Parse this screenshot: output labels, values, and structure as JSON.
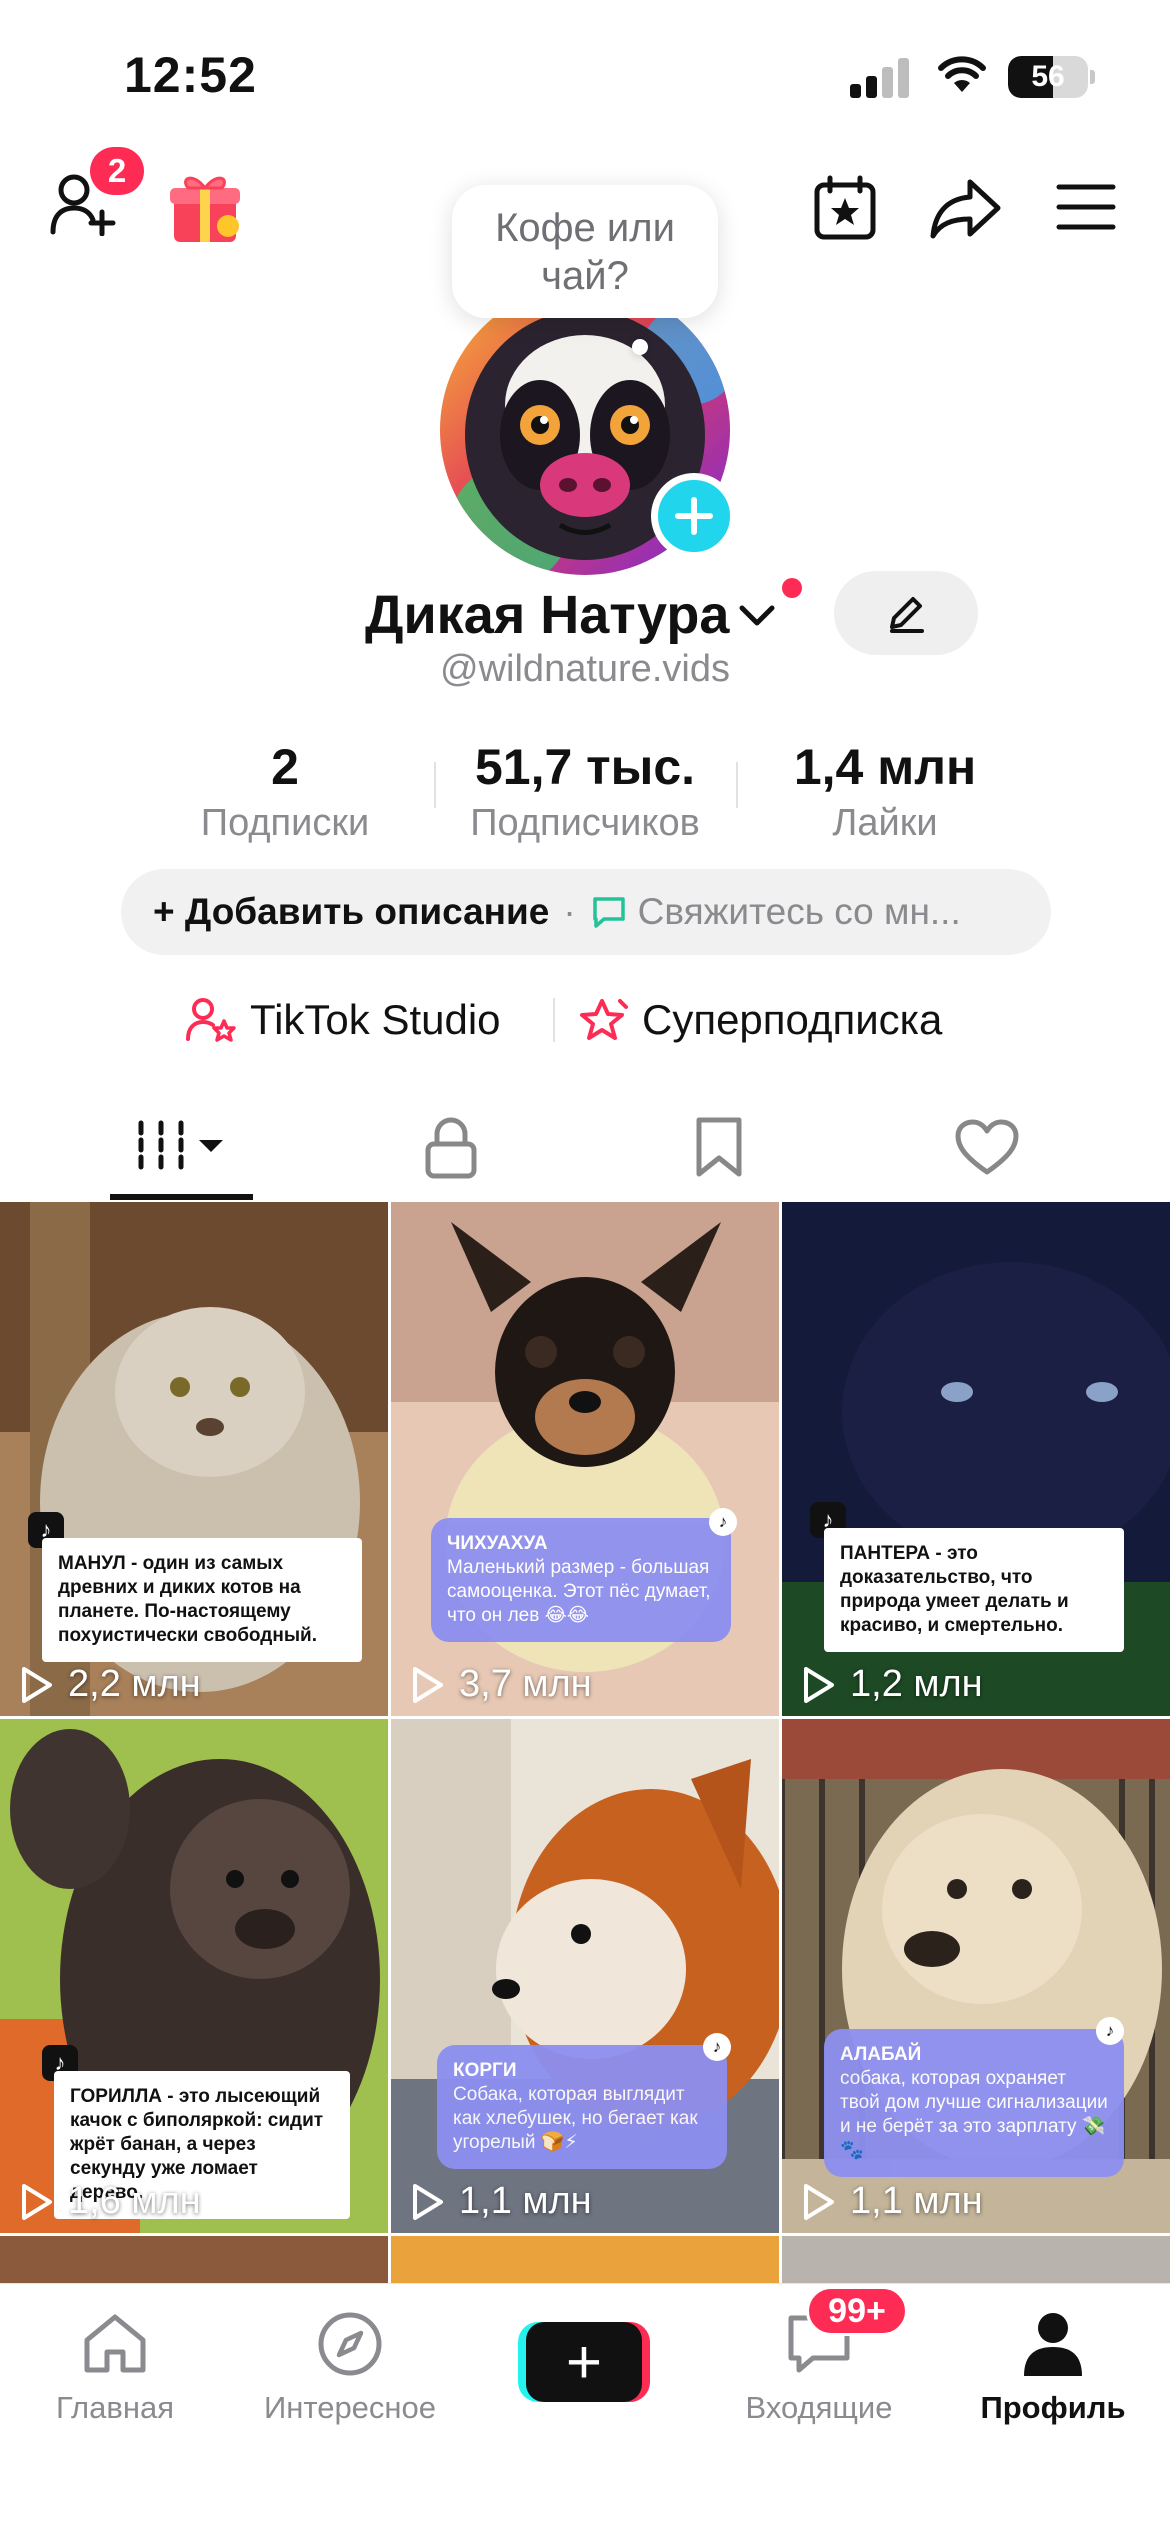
{
  "status_bar": {
    "time": "12:52",
    "battery": "56",
    "battery_level": 0.56
  },
  "header": {
    "friends_badge": "2",
    "icons": [
      "add-friend-icon",
      "gift-icon",
      "calendar-star-icon",
      "share-icon",
      "menu-icon"
    ]
  },
  "profile": {
    "bubble_text": "Кофе или чай?",
    "name": "Дикая Натура",
    "username": "@wildnature.vids"
  },
  "stats": [
    {
      "value": "2",
      "label": "Подписки"
    },
    {
      "value": "51,7 тыс.",
      "label": "Подписчиков"
    },
    {
      "value": "1,4 млн",
      "label": "Лайки"
    }
  ],
  "description": {
    "add_label": "+ Добавить описание",
    "separator": "·",
    "contact_label": "Свяжитесь со мн..."
  },
  "studio": {
    "studio_label": "TikTok Studio",
    "super_label": "Суперподписка"
  },
  "tabs": [
    "videos-grid-icon",
    "lock-icon",
    "bookmark-icon",
    "heart-icon"
  ],
  "videos": [
    {
      "caption": "МАНУЛ - один из самых древних и диких котов на планете. По-настоящему похуистически свободный.",
      "views": "2,2 млн"
    },
    {
      "caption_title": "ЧИХУАХУА",
      "caption": "Маленький размер - большая самооценка. Этот пёс думает, что он лев 😂😂",
      "views": "3,7 млн"
    },
    {
      "caption": "ПАНТЕРА - это доказательство, что природа умеет делать и красиво, и смертельно.",
      "views": "1,2 млн"
    },
    {
      "caption": "ГОРИЛЛА - это лысеющий качок с биполяркой: сидит жрёт банан, а через секунду уже ломает дерево.",
      "views": "1,6 млн"
    },
    {
      "caption_title": "КОРГИ",
      "caption": "Собака, которая выглядит как хлебушек, но бегает как угорелый 🍞⚡",
      "views": "1,1 млн"
    },
    {
      "caption_title": "АЛАБАЙ",
      "caption": "собака, которая охраняет твой дом лучше сигнализации и не берёт за это зарплату 💸🐾",
      "views": "1,1 млн"
    }
  ],
  "bottom_nav": [
    {
      "label": "Главная",
      "icon": "home-icon"
    },
    {
      "label": "Интересное",
      "icon": "compass-icon"
    },
    {
      "label": "",
      "icon": "create-icon"
    },
    {
      "label": "Входящие",
      "icon": "inbox-icon"
    },
    {
      "label": "Профиль",
      "icon": "profile-icon"
    }
  ],
  "inbox_badge": "99+",
  "colors": {
    "accent": "#fe2c55",
    "cyan": "#25f4ee",
    "add_blue": "#20d5ec",
    "muted": "#8a8a8f"
  }
}
